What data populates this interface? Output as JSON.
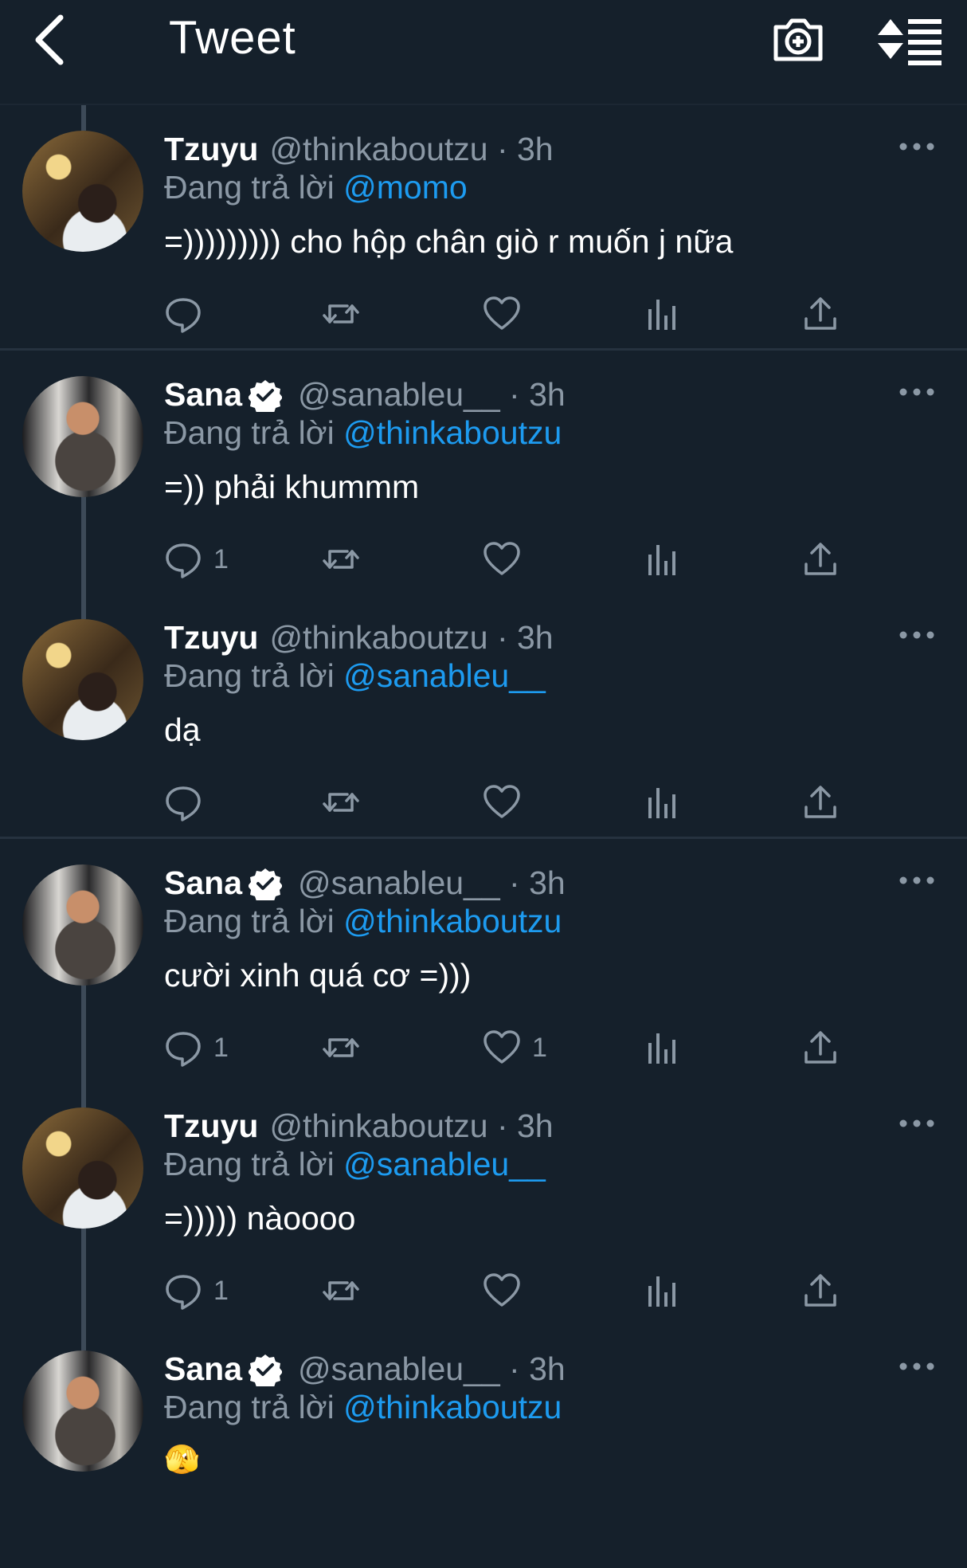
{
  "header": {
    "title": "Tweet",
    "icons": [
      "back-arrow-icon",
      "camera-plus-icon",
      "sort-list-icon"
    ]
  },
  "colors": {
    "background": "#15202b",
    "secondary_text": "#8b98a5",
    "mention": "#1d9bf0"
  },
  "tweets": [
    {
      "name": "Tzuyu",
      "verified": false,
      "handle_time": "@thinkaboutzu · 3h",
      "reply_prefix": "Đang trả lời",
      "reply_to": "@momo",
      "text": "=))))))))) cho hộp chân giò r muốn j nữa",
      "reply_count": "",
      "like_count": ""
    },
    {
      "name": "Sana",
      "verified": true,
      "handle_time": "@sanableu__ · 3h",
      "reply_prefix": "Đang trả lời",
      "reply_to": "@thinkaboutzu",
      "text": "=)) phải khummm",
      "reply_count": "1",
      "like_count": ""
    },
    {
      "name": "Tzuyu",
      "verified": false,
      "handle_time": "@thinkaboutzu · 3h",
      "reply_prefix": "Đang trả lời",
      "reply_to": "@sanableu__",
      "text": "dạ",
      "reply_count": "",
      "like_count": ""
    },
    {
      "name": "Sana",
      "verified": true,
      "handle_time": "@sanableu__ · 3h",
      "reply_prefix": "Đang trả lời",
      "reply_to": "@thinkaboutzu",
      "text": "cười xinh quá cơ =)))",
      "reply_count": "1",
      "like_count": "1"
    },
    {
      "name": "Tzuyu",
      "verified": false,
      "handle_time": "@thinkaboutzu · 3h",
      "reply_prefix": "Đang trả lời",
      "reply_to": "@sanableu__",
      "text": "=))))) nàoooo",
      "reply_count": "1",
      "like_count": ""
    },
    {
      "name": "Sana",
      "verified": true,
      "handle_time": "@sanableu__ · 3h",
      "reply_prefix": "Đang trả lời",
      "reply_to": "@thinkaboutzu",
      "text": "🫣",
      "reply_count": "",
      "like_count": ""
    }
  ]
}
